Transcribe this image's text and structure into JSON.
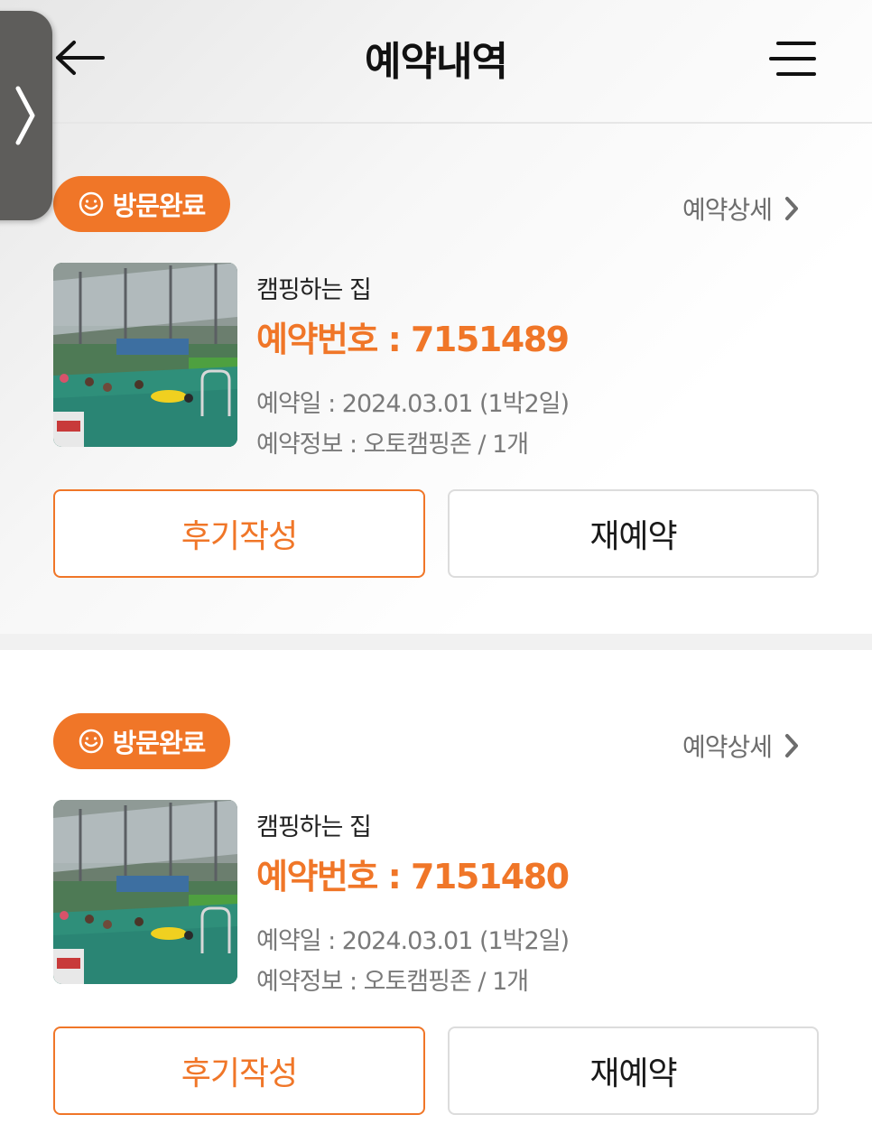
{
  "header": {
    "title": "예약내역",
    "back_icon": "arrow-left-icon",
    "menu_icon": "hamburger-menu-icon"
  },
  "side_handle": {
    "icon": "chevron-right-icon"
  },
  "colors": {
    "accent": "#f07628",
    "badge_text": "#ffffff",
    "muted_text": "#7a7a7a"
  },
  "reservations": [
    {
      "status": "방문완료",
      "status_icon": "smile-icon",
      "detail_link": "예약상세",
      "place_name": "캠핑하는 집",
      "reservation_number": "예약번호 : 7151489",
      "date_line": "예약일 : 2024.03.01 (1박2일)",
      "info_line": "예약정보 : 오토캠핑존 / 1개",
      "review_button": "후기작성",
      "rebook_button": "재예약"
    },
    {
      "status": "방문완료",
      "status_icon": "smile-icon",
      "detail_link": "예약상세",
      "place_name": "캠핑하는 집",
      "reservation_number": "예약번호 : 7151480",
      "date_line": "예약일 : 2024.03.01 (1박2일)",
      "info_line": "예약정보 : 오토캠핑존 / 1개",
      "review_button": "후기작성",
      "rebook_button": "재예약"
    }
  ]
}
